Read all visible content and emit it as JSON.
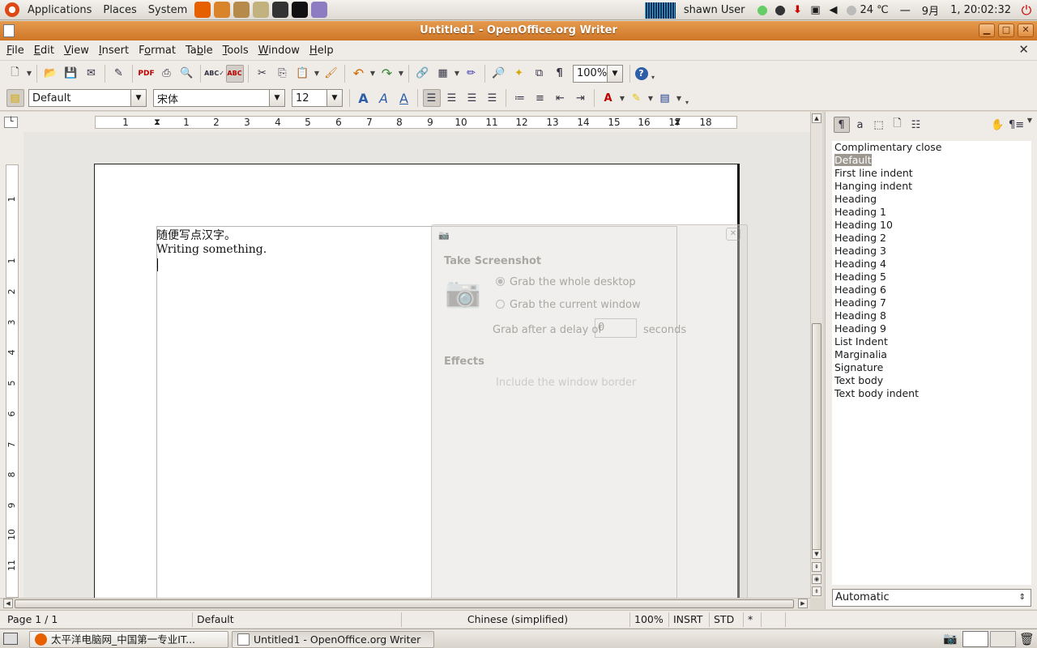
{
  "top_panel": {
    "menus": [
      "Applications",
      "Places",
      "System"
    ],
    "launchers": [
      {
        "name": "firefox-icon",
        "color": "#e66000"
      },
      {
        "name": "pidgin-icon",
        "color": "#d9832b"
      },
      {
        "name": "search-icon",
        "color": "#b58a4b"
      },
      {
        "name": "archive-icon",
        "color": "#c2b280"
      },
      {
        "name": "terminal-icon",
        "color": "#333333"
      },
      {
        "name": "qq-penguin-icon",
        "color": "#111111"
      },
      {
        "name": "pidgin-bird-icon",
        "color": "#8e7cc3"
      }
    ],
    "user": "shawn User",
    "weather": "24 ℃",
    "date_sep": "一",
    "month": "9月",
    "datetime": "1, 20:02:32"
  },
  "window": {
    "title": "Untitled1 - OpenOffice.org Writer",
    "title_color": "#d9812f"
  },
  "menubar": {
    "items": [
      {
        "label": "File",
        "key": "F"
      },
      {
        "label": "Edit",
        "key": "E"
      },
      {
        "label": "View",
        "key": "V"
      },
      {
        "label": "Insert",
        "key": "I"
      },
      {
        "label": "Format",
        "key": "o"
      },
      {
        "label": "Table",
        "key": "b"
      },
      {
        "label": "Tools",
        "key": "T"
      },
      {
        "label": "Window",
        "key": "W"
      },
      {
        "label": "Help",
        "key": "H"
      }
    ]
  },
  "standard_bar": {
    "zoom": "100%"
  },
  "format_bar": {
    "paragraph_style": "Default",
    "font_name": "宋体",
    "font_size": "12"
  },
  "ruler": {
    "h_labels": [
      "1",
      "1",
      "2",
      "3",
      "4",
      "5",
      "6",
      "7",
      "8",
      "9",
      "10",
      "11",
      "12",
      "13",
      "14",
      "15",
      "16",
      "17",
      "18"
    ],
    "v_labels": [
      "1",
      "1",
      "2",
      "3",
      "4",
      "5",
      "6",
      "7",
      "8",
      "9",
      "10",
      "11"
    ]
  },
  "document": {
    "lines": [
      "随便写点汉字。",
      "Writing something."
    ]
  },
  "ghost_dialog": {
    "heading": "Take Screenshot",
    "option1": "Grab the whole desktop",
    "option2": "Grab the current window",
    "delay_prefix": "Grab after a delay of",
    "delay_value": "0",
    "delay_suffix": "seconds",
    "effects_heading": "Effects",
    "effects_option": "Include the window border"
  },
  "stylist": {
    "styles": [
      "Complimentary close",
      "Default",
      "First line indent",
      "Hanging indent",
      "Heading",
      "Heading 1",
      "Heading 10",
      "Heading 2",
      "Heading 3",
      "Heading 4",
      "Heading 5",
      "Heading 6",
      "Heading 7",
      "Heading 8",
      "Heading 9",
      "List Indent",
      "Marginalia",
      "Signature",
      "Text body",
      "Text body indent"
    ],
    "selected": "Default",
    "filter": "Automatic"
  },
  "statusbar": {
    "page": "Page 1 / 1",
    "style": "Default",
    "language": "Chinese (simplified)",
    "zoom": "100%",
    "insert_mode": "INSRT",
    "selection_mode": "STD",
    "modified": "*"
  },
  "taskbar": {
    "tasks": [
      {
        "label": "太平洋电脑网_中国第一专业IT...",
        "icon_color": "#e66000"
      },
      {
        "label": "Untitled1 - OpenOffice.org Writer",
        "icon_color": "#ffffff"
      }
    ]
  }
}
